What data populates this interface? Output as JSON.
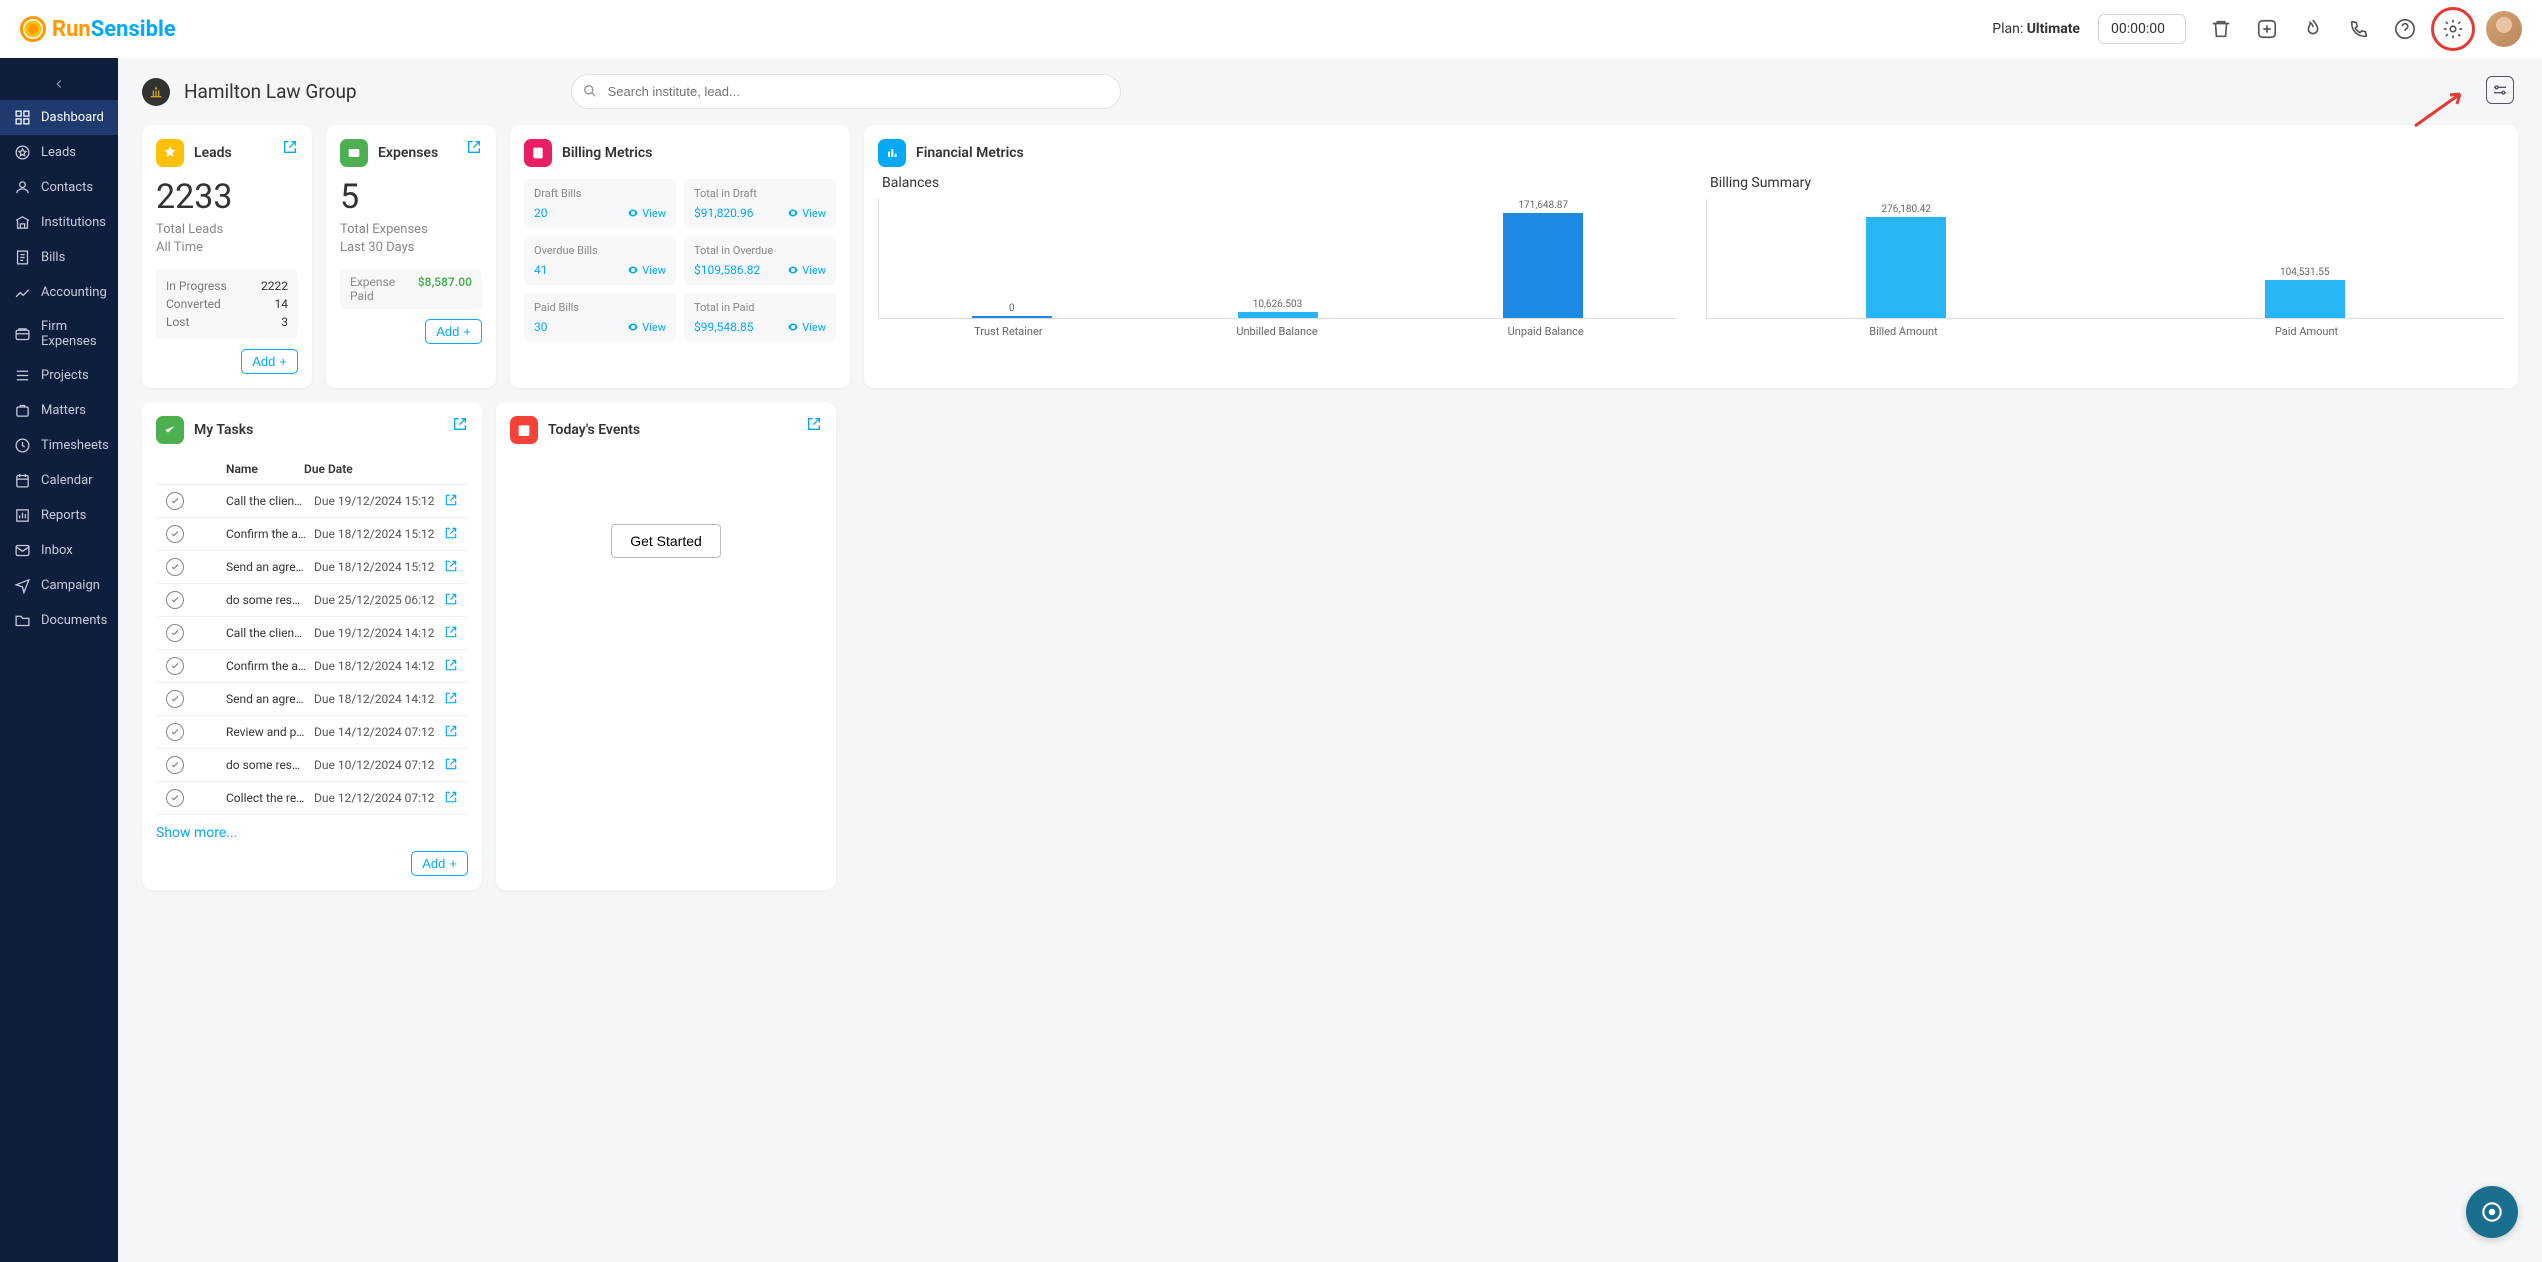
{
  "brand": {
    "name1": "Run",
    "name2": "Sensible"
  },
  "topbar": {
    "plan_label": "Plan:",
    "plan_value": "Ultimate",
    "timer": "00:00:00"
  },
  "sidebar": {
    "items": [
      {
        "label": "Dashboard"
      },
      {
        "label": "Leads"
      },
      {
        "label": "Contacts"
      },
      {
        "label": "Institutions"
      },
      {
        "label": "Bills"
      },
      {
        "label": "Accounting"
      },
      {
        "label": "Firm Expenses"
      },
      {
        "label": "Projects"
      },
      {
        "label": "Matters"
      },
      {
        "label": "Timesheets"
      },
      {
        "label": "Calendar"
      },
      {
        "label": "Reports"
      },
      {
        "label": "Inbox"
      },
      {
        "label": "Campaign"
      },
      {
        "label": "Documents"
      }
    ]
  },
  "header": {
    "org_name": "Hamilton Law Group",
    "search_placeholder": "Search institute, lead..."
  },
  "leads_card": {
    "title": "Leads",
    "count": "2233",
    "sub1": "Total Leads",
    "sub2": "All Time",
    "stats": [
      {
        "label": "In Progress",
        "value": "2222"
      },
      {
        "label": "Converted",
        "value": "14"
      },
      {
        "label": "Lost",
        "value": "3"
      }
    ]
  },
  "expenses_card": {
    "title": "Expenses",
    "count": "5",
    "sub1": "Total Expenses",
    "sub2": "Last 30 Days",
    "paid_label": "Expense Paid",
    "paid_value": "$8,587.00"
  },
  "billing_card": {
    "title": "Billing Metrics",
    "rows": [
      {
        "l1": "Draft Bills",
        "v1": "20",
        "l2": "Total in Draft",
        "v2": "$91,820.96"
      },
      {
        "l1": "Overdue Bills",
        "v1": "41",
        "l2": "Total in Overdue",
        "v2": "$109,586.82"
      },
      {
        "l1": "Paid Bills",
        "v1": "30",
        "l2": "Total in Paid",
        "v2": "$99,548.85"
      }
    ],
    "view": "View"
  },
  "financial_card": {
    "title": "Financial Metrics",
    "chart1_title": "Balances",
    "chart2_title": "Billing Summary"
  },
  "tasks_card": {
    "title": "My Tasks",
    "col_name": "Name",
    "col_due": "Due Date",
    "show_more": "Show more...",
    "rows": [
      {
        "name": "Call the client for the a...",
        "due": "Due  19/12/2024 15:12"
      },
      {
        "name": "Confirm the agreement...",
        "due": "Due  18/12/2024 15:12"
      },
      {
        "name": "Send an agreement",
        "due": "Due  18/12/2024 15:12"
      },
      {
        "name": "do some researches a...",
        "due": "Due  25/12/2025 06:12"
      },
      {
        "name": "Call the client for the a...",
        "due": "Due  19/12/2024 14:12"
      },
      {
        "name": "Confirm the agreement...",
        "due": "Due  18/12/2024 14:12"
      },
      {
        "name": "Send an agreement",
        "due": "Due  18/12/2024 14:12"
      },
      {
        "name": "Review and prepare th...",
        "due": "Due  14/12/2024 07:12"
      },
      {
        "name": "do some researches a...",
        "due": "Due  10/12/2024 07:12"
      },
      {
        "name": "Collect the required do...",
        "due": "Due  12/12/2024 07:12"
      }
    ]
  },
  "events_card": {
    "title": "Today's Events",
    "get_started": "Get Started"
  },
  "common": {
    "add": "Add"
  },
  "chart_data": [
    {
      "type": "bar",
      "title": "Balances",
      "categories": [
        "Trust Retainer",
        "Unbilled Balance",
        "Unpaid Balance"
      ],
      "values": [
        0,
        10626.503,
        171648.87
      ],
      "ylim": [
        0,
        180000
      ]
    },
    {
      "type": "bar",
      "title": "Billing Summary",
      "categories": [
        "Billed Amount",
        "Paid Amount"
      ],
      "values": [
        276180.42,
        104531.55
      ],
      "ylim": [
        0,
        300000
      ]
    }
  ]
}
